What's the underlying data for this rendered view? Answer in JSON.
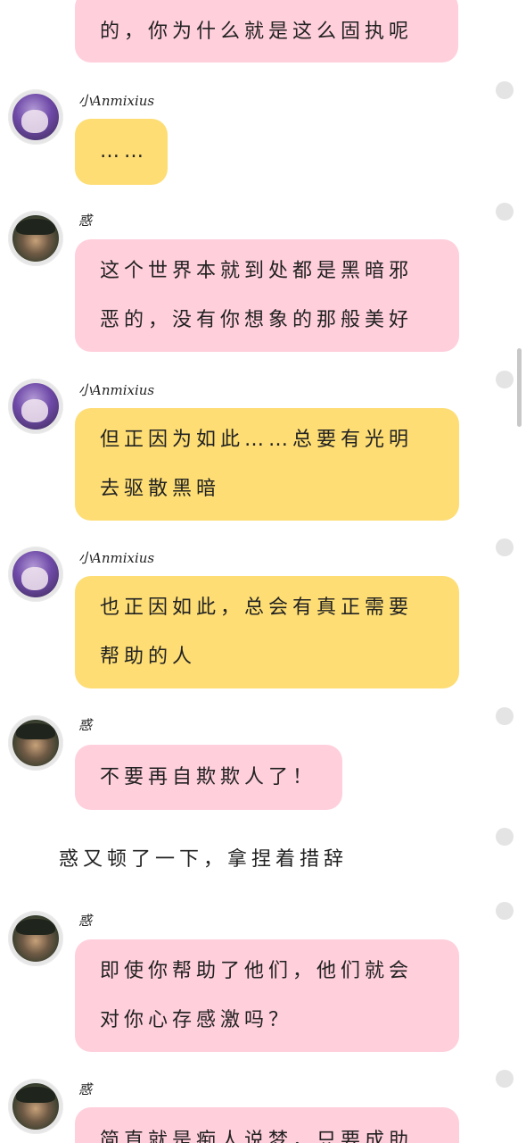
{
  "messages": [
    {
      "speaker": "",
      "text": "的，你为什么就是这么固执呢"
    },
    {
      "speaker": "小Anmixius",
      "text": "……"
    },
    {
      "speaker": "惑",
      "line1": "这个世界本就到处都是黑暗邪",
      "line2": "恶的，没有你想象的那般美好"
    },
    {
      "speaker": "小Anmixius",
      "line1": "但正因为如此……总要有光明",
      "line2": "去驱散黑暗"
    },
    {
      "speaker": "小Anmixius",
      "line1": "也正因如此，总会有真正需要",
      "line2": "帮助的人"
    },
    {
      "speaker": "惑",
      "text": "不要再自欺欺人了！"
    },
    {
      "narration": "惑又顿了一下，拿捏着措辞"
    },
    {
      "speaker": "惑",
      "line1": "即使你帮助了他们，他们就会",
      "line2": "对你心存感激吗？"
    },
    {
      "speaker": "惑",
      "text": "简直就是痴人说梦，只要成助"
    }
  ],
  "colors": {
    "pink_bubble": "#ffcfdc",
    "yellow_bubble": "#fddd74",
    "background": "#ffffff"
  }
}
